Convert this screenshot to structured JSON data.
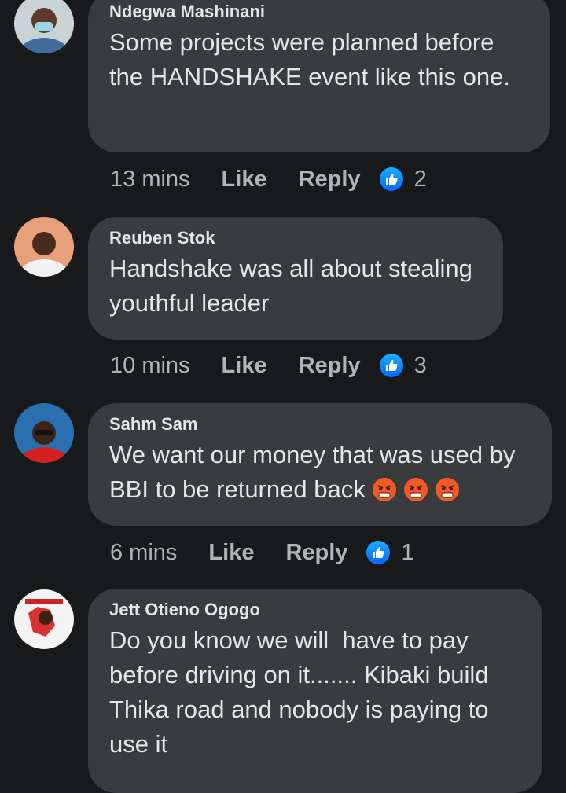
{
  "comments": [
    {
      "author": "Ndegwa Mashinani",
      "text": "Some projects were planned before the HANDSHAKE event like this one.",
      "time": "13 mins",
      "like_label": "Like",
      "reply_label": "Reply",
      "reaction_icon": "thumbs-up-icon",
      "reaction_count": "2"
    },
    {
      "author": "Reuben Stok",
      "text": "Handshake was all about stealing youthful leader",
      "time": "10 mins",
      "like_label": "Like",
      "reply_label": "Reply",
      "reaction_icon": "thumbs-up-icon",
      "reaction_count": "3"
    },
    {
      "author": "Sahm Sam",
      "text": "We want our money that was used by BBI to be returned back",
      "emoji": [
        "angry-face-icon",
        "angry-face-icon",
        "angry-face-icon"
      ],
      "time": "6 mins",
      "like_label": "Like",
      "reply_label": "Reply",
      "reaction_icon": "thumbs-up-icon",
      "reaction_count": "1"
    },
    {
      "author": "Jett Otieno Ogogo",
      "text": "Do you know we will  have to pay before driving on it....... Kibaki build Thika road and nobody is paying to use it"
    }
  ],
  "colors": {
    "background": "#18191a",
    "bubble": "#3a3b3c",
    "text": "#e4e6eb",
    "secondary": "#b0b3b8",
    "like_blue": "#0866ff",
    "angry": "#f15a24"
  }
}
